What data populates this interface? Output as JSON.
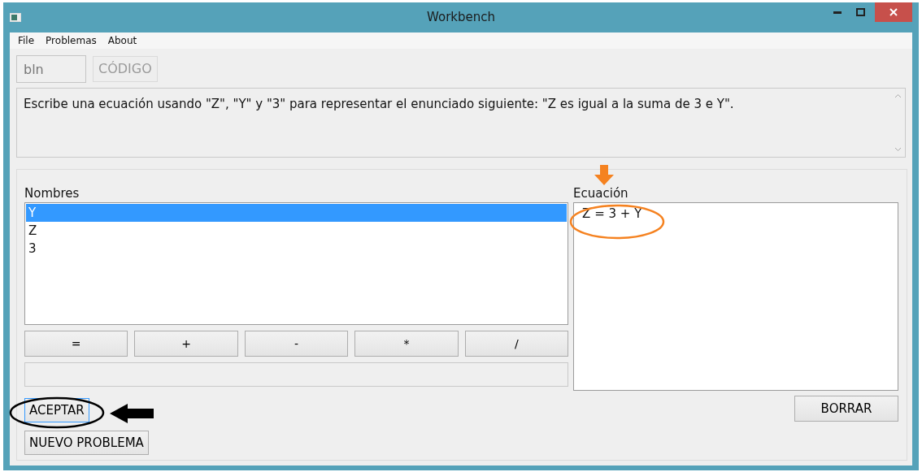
{
  "window": {
    "title": "Workbench"
  },
  "menu": [
    "File",
    "Problemas",
    "About"
  ],
  "toolbar": {
    "field": {
      "value": "bln"
    },
    "code_button": {
      "label": "CÓDIGO",
      "disabled": true
    }
  },
  "prompt": "Escribe una ecuación usando \"Z\", \"Y\" y \"3\" para representar el enunciado siguiente: \"Z es igual a la suma de 3 e Y\".",
  "names": {
    "label": "Nombres",
    "items": [
      {
        "text": "Y",
        "selected": true
      },
      {
        "text": "Z",
        "selected": false
      },
      {
        "text": "3",
        "selected": false
      }
    ]
  },
  "operators": [
    "=",
    "+",
    "-",
    "*",
    "/"
  ],
  "equation": {
    "label": "Ecuación",
    "text": "Z = 3 + Y"
  },
  "buttons": {
    "accept": "ACEPTAR",
    "new_problem": "NUEVO PROBLEMA",
    "clear": "BORRAR"
  }
}
